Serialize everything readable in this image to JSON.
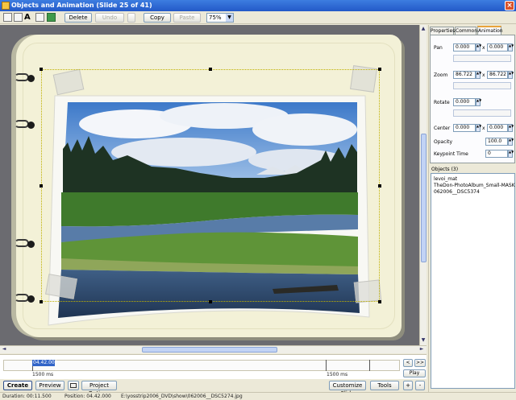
{
  "window": {
    "title": "Objects and Animation  (Slide 25 of 41)",
    "close": "×"
  },
  "toolbar": {
    "delete_label": "Delete",
    "undo_label": "Undo",
    "copy_label": "Copy",
    "paste_label": "Paste",
    "zoom_value": "75%"
  },
  "panel": {
    "tabs": [
      "Properties",
      "Common",
      "Animation"
    ],
    "active_tab": "Animation",
    "pan": {
      "label": "Pan",
      "x": "0.000",
      "y": "0.000",
      "sep": "x"
    },
    "zoom": {
      "label": "Zoom",
      "x": "86.722",
      "y": "86.722",
      "sep": "x"
    },
    "rotate": {
      "label": "Rotate",
      "value": "0.000"
    },
    "center": {
      "label": "Center",
      "x": "0.000",
      "y": "0.000",
      "sep": "x"
    },
    "opacity": {
      "label": "Opacity",
      "value": "100.0"
    },
    "keypoint_time": {
      "label": "Keypoint Time",
      "value": "0"
    }
  },
  "objects": {
    "label": "Objects (3)",
    "items": [
      "levoi_mat",
      "TheDon-PhotoAlbum_Small-MASK",
      "062006__DSC5374"
    ]
  },
  "timeline": {
    "position_value": "04.42.000",
    "segment_left": "1500 ms",
    "segment_right": "1500 ms",
    "prev_label": "<",
    "next_label": ">>",
    "play_label": "Play"
  },
  "bottom": {
    "create_label": "Create",
    "preview_label": "Preview",
    "project_options_label": "Project Options",
    "customize_slide_label": "Customize Slide",
    "tools_label": "Tools",
    "add_label": "+",
    "remove_label": "-"
  },
  "status": {
    "duration": "Duration:  00:11.500",
    "position": "Position:  04.42.000",
    "file": "E:\\yosstrip2006_DVD\\show\\062006__DSC5274.jpg"
  },
  "colors": {
    "accent": "#2359c8",
    "tab_highlight": "#e8a33c",
    "selection": "#3164c8"
  }
}
